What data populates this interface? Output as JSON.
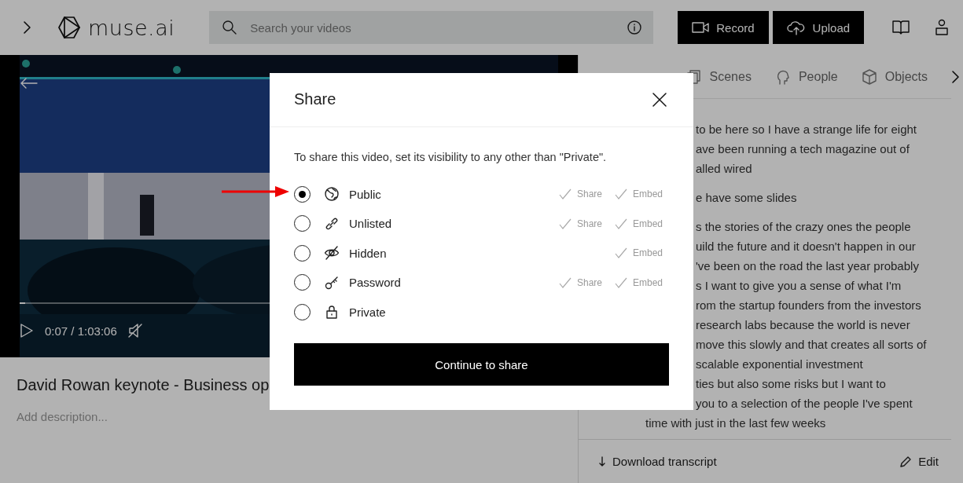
{
  "header": {
    "logo": "muse.ai",
    "search": {
      "placeholder": "Search your videos"
    },
    "buttons": [
      {
        "kind": "record",
        "label": "Record"
      },
      {
        "kind": "upload",
        "label": "Upload"
      }
    ]
  },
  "video": {
    "time": "0:07 / 1:03:06",
    "level": 0.01,
    "title": "David Rowan keynote - Business op",
    "description_placeholder": "Add description..."
  },
  "tabs": [
    {
      "kind": "scenes",
      "label": "Scenes"
    },
    {
      "kind": "people",
      "label": "People"
    },
    {
      "kind": "objects",
      "label": "Objects"
    }
  ],
  "transcript": [
    {
      "lines": [
        {
          "kind": "partial",
          "text": "to be here so I have a strange life for eight"
        },
        {
          "kind": "partial",
          "text": "ave been running a tech magazine out of"
        },
        {
          "kind": "partial",
          "text": "alled wired"
        }
      ]
    },
    {
      "lines": [
        {
          "kind": "partial",
          "text": "e have some slides"
        }
      ]
    },
    {
      "lines": [
        {
          "kind": "partial",
          "text": "s the stories of the crazy ones the people"
        },
        {
          "kind": "partial",
          "text": "uild the future and it doesn't happen in our"
        },
        {
          "kind": "partial",
          "text": "'ve been on the road the last year probably"
        },
        {
          "kind": "partial",
          "text": "s I want to give you a sense of what I'm"
        },
        {
          "kind": "partial",
          "text": "rom the startup founders from the investors"
        },
        {
          "kind": "partial",
          "text": "research labs because the world is never"
        },
        {
          "kind": "partial",
          "text": "move this slowly and that creates all sorts of"
        },
        {
          "kind": "partial",
          "text": "scalable exponential investment"
        },
        {
          "kind": "partial",
          "text": "ties but also some risks but I want to"
        },
        {
          "kind": "partial",
          "text": "you to a selection of the people I've spent"
        },
        {
          "kind": "full",
          "text": "time with just in the last few weeks"
        }
      ]
    }
  ],
  "footer": {
    "download": "Download transcript",
    "edit": "Edit"
  },
  "dialog": {
    "title": "Share",
    "intro": "To share this video, set its visibility to any other than \"Private\".",
    "options": [
      {
        "kind": "globe",
        "label": "Public",
        "selected": true,
        "share": "Share",
        "embed": "Embed"
      },
      {
        "kind": "link",
        "label": "Unlisted",
        "selected": false,
        "share": "Share",
        "embed": "Embed"
      },
      {
        "kind": "hidden",
        "label": "Hidden",
        "selected": false,
        "embed": "Embed"
      },
      {
        "kind": "key",
        "label": "Password",
        "selected": false,
        "share": "Share",
        "embed": "Embed"
      },
      {
        "kind": "lock",
        "label": "Private",
        "selected": false
      }
    ],
    "button": "Continue to share"
  }
}
